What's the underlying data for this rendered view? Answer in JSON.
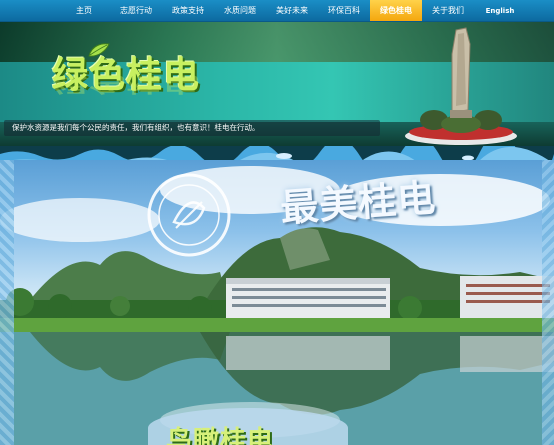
{
  "nav": {
    "items": [
      {
        "label": "主页"
      },
      {
        "label": "志愿行动"
      },
      {
        "label": "政策支持"
      },
      {
        "label": "水质问题"
      },
      {
        "label": "美好未来"
      },
      {
        "label": "环保百科"
      },
      {
        "label": "绿色桂电",
        "active": true
      },
      {
        "label": "关于我们"
      },
      {
        "label": "English"
      }
    ]
  },
  "banner": {
    "title": "绿色桂电",
    "slogan": "保护水资源是我们每个公民的责任，我们有组织，也有意识！桂电在行动。"
  },
  "photo": {
    "title": "最美桂电",
    "bottom_title": "鸟瞰桂电"
  },
  "colors": {
    "nav_bg": "#1a8ec6",
    "nav_active": "#f4a70e",
    "title_green": "#c8f060"
  },
  "icons": {
    "leaf": "leaf-icon",
    "seal": "university-seal",
    "monument": "stone-monument"
  }
}
